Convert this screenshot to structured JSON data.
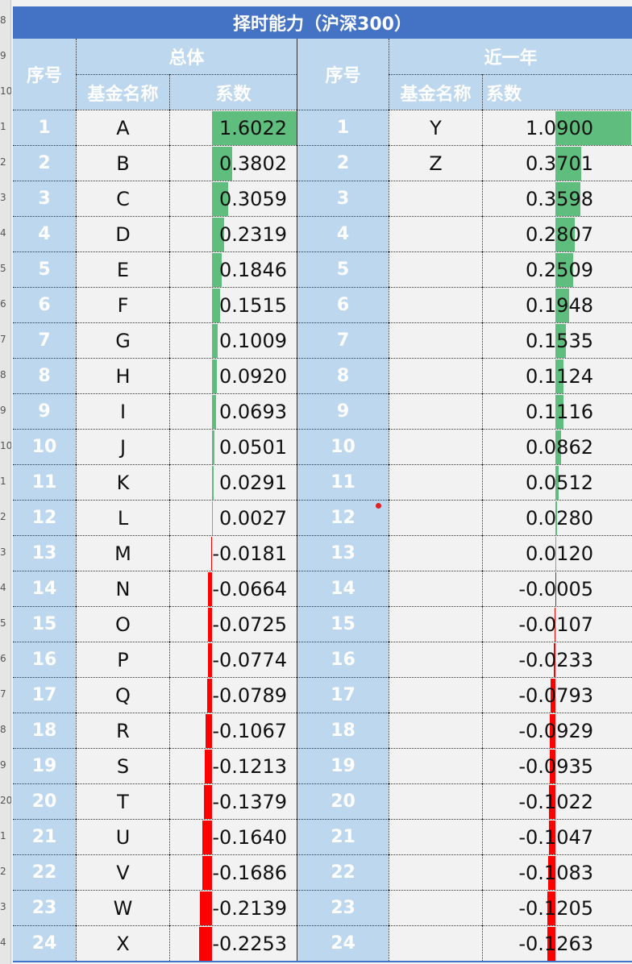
{
  "title": "择时能力（沪深300）",
  "headers": {
    "index_label": "序号",
    "overall_label": "总体",
    "recent_label": "近一年",
    "fund_name_label": "基金名称",
    "coef_label": "系数"
  },
  "colors": {
    "positive": "#5fbe7d",
    "negative": "#ff0000",
    "header_bg": "#bdd7ee",
    "title_bg": "#4472c4"
  },
  "row_numbers": [
    "8",
    "9",
    "10",
    "1",
    "2",
    "3",
    "4",
    "5",
    "6",
    "7",
    "8",
    "9",
    "10",
    "1",
    "2",
    "3",
    "4",
    "5",
    "6",
    "7",
    "8",
    "9",
    "20",
    "1",
    "2",
    "3",
    "4"
  ],
  "rows": [
    {
      "idx": "1",
      "name": "A",
      "coef": "1.6022",
      "coef_val": 1.6022,
      "name2": "Y",
      "coef2": "1.0900",
      "coef2_val": 1.09
    },
    {
      "idx": "2",
      "name": "B",
      "coef": "0.3802",
      "coef_val": 0.3802,
      "name2": "Z",
      "coef2": "0.3701",
      "coef2_val": 0.3701
    },
    {
      "idx": "3",
      "name": "C",
      "coef": "0.3059",
      "coef_val": 0.3059,
      "name2": "",
      "coef2": "0.3598",
      "coef2_val": 0.3598
    },
    {
      "idx": "4",
      "name": "D",
      "coef": "0.2319",
      "coef_val": 0.2319,
      "name2": "",
      "coef2": "0.2807",
      "coef2_val": 0.2807
    },
    {
      "idx": "5",
      "name": "E",
      "coef": "0.1846",
      "coef_val": 0.1846,
      "name2": "",
      "coef2": "0.2509",
      "coef2_val": 0.2509
    },
    {
      "idx": "6",
      "name": "F",
      "coef": "0.1515",
      "coef_val": 0.1515,
      "name2": "",
      "coef2": "0.1948",
      "coef2_val": 0.1948
    },
    {
      "idx": "7",
      "name": "G",
      "coef": "0.1009",
      "coef_val": 0.1009,
      "name2": "",
      "coef2": "0.1535",
      "coef2_val": 0.1535
    },
    {
      "idx": "8",
      "name": "H",
      "coef": "0.0920",
      "coef_val": 0.092,
      "name2": "",
      "coef2": "0.1124",
      "coef2_val": 0.1124
    },
    {
      "idx": "9",
      "name": "I",
      "coef": "0.0693",
      "coef_val": 0.0693,
      "name2": "",
      "coef2": "0.1116",
      "coef2_val": 0.1116
    },
    {
      "idx": "10",
      "name": "J",
      "coef": "0.0501",
      "coef_val": 0.0501,
      "name2": "",
      "coef2": "0.0862",
      "coef2_val": 0.0862
    },
    {
      "idx": "11",
      "name": "K",
      "coef": "0.0291",
      "coef_val": 0.0291,
      "name2": "",
      "coef2": "0.0512",
      "coef2_val": 0.0512
    },
    {
      "idx": "12",
      "name": "L",
      "coef": "0.0027",
      "coef_val": 0.0027,
      "name2": "",
      "coef2": "0.0280",
      "coef2_val": 0.028
    },
    {
      "idx": "13",
      "name": "M",
      "coef": "-0.0181",
      "coef_val": -0.0181,
      "name2": "",
      "coef2": "0.0120",
      "coef2_val": 0.012
    },
    {
      "idx": "14",
      "name": "N",
      "coef": "-0.0664",
      "coef_val": -0.0664,
      "name2": "",
      "coef2": "-0.0005",
      "coef2_val": -0.0005
    },
    {
      "idx": "15",
      "name": "O",
      "coef": "-0.0725",
      "coef_val": -0.0725,
      "name2": "",
      "coef2": "-0.0107",
      "coef2_val": -0.0107
    },
    {
      "idx": "16",
      "name": "P",
      "coef": "-0.0774",
      "coef_val": -0.0774,
      "name2": "",
      "coef2": "-0.0233",
      "coef2_val": -0.0233
    },
    {
      "idx": "17",
      "name": "Q",
      "coef": "-0.0789",
      "coef_val": -0.0789,
      "name2": "",
      "coef2": "-0.0793",
      "coef2_val": -0.0793
    },
    {
      "idx": "18",
      "name": "R",
      "coef": "-0.1067",
      "coef_val": -0.1067,
      "name2": "",
      "coef2": "-0.0929",
      "coef2_val": -0.0929
    },
    {
      "idx": "19",
      "name": "S",
      "coef": "-0.1213",
      "coef_val": -0.1213,
      "name2": "",
      "coef2": "-0.0935",
      "coef2_val": -0.0935
    },
    {
      "idx": "20",
      "name": "T",
      "coef": "-0.1379",
      "coef_val": -0.1379,
      "name2": "",
      "coef2": "-0.1022",
      "coef2_val": -0.1022
    },
    {
      "idx": "21",
      "name": "U",
      "coef": "-0.1640",
      "coef_val": -0.164,
      "name2": "",
      "coef2": "-0.1047",
      "coef2_val": -0.1047
    },
    {
      "idx": "22",
      "name": "V",
      "coef": "-0.1686",
      "coef_val": -0.1686,
      "name2": "",
      "coef2": "-0.1083",
      "coef2_val": -0.1083
    },
    {
      "idx": "23",
      "name": "W",
      "coef": "-0.2139",
      "coef_val": -0.2139,
      "name2": "",
      "coef2": "-0.1205",
      "coef2_val": -0.1205
    },
    {
      "idx": "24",
      "name": "X",
      "coef": "-0.2253",
      "coef_val": -0.2253,
      "name2": "",
      "coef2": "-0.1263",
      "coef2_val": -0.1263
    }
  ]
}
